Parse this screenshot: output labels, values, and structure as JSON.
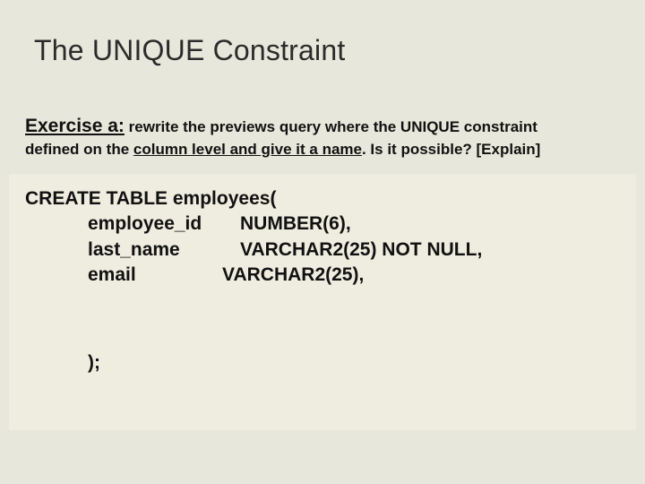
{
  "title": "The UNIQUE Constraint",
  "exercise": {
    "label": "Exercise a:",
    "part1": " rewrite the previews query where the UNIQUE constraint",
    "part2a": "defined on the ",
    "underlined": "column level and give it a name",
    "part2b": ". Is it possible? [Explain]"
  },
  "code": {
    "line1": "CREATE TABLE employees(",
    "col1_name": "employee_id",
    "col1_type": "NUMBER(6),",
    "col2_name": "last_name",
    "col2_type": "VARCHAR2(25) NOT NULL,",
    "col3_name": "email",
    "col3_type": "VARCHAR2(25),",
    "close": ");"
  }
}
